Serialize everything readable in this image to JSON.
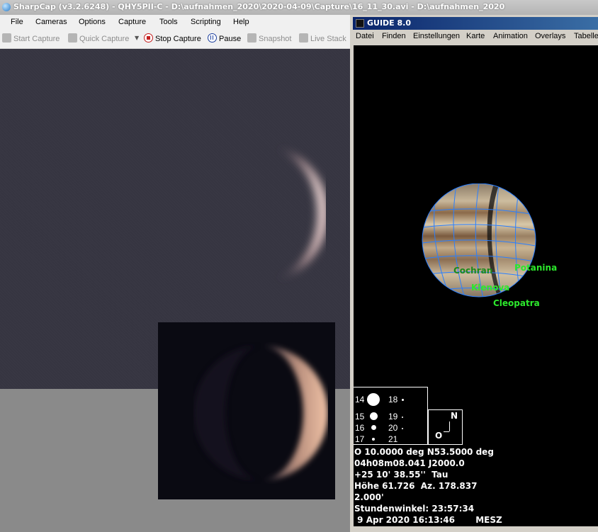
{
  "sharpcap": {
    "title": "SharpCap (v3.2.6248) - QHY5PII-C - D:\\aufnahmen_2020\\2020-04-09\\Capture\\16_11_30.avi - D:\\aufnahmen_2020",
    "menu": [
      "File",
      "Cameras",
      "Options",
      "Capture",
      "Tools",
      "Scripting",
      "Help"
    ],
    "toolbar": {
      "start_capture": "Start Capture",
      "quick_capture": "Quick Capture",
      "stop_capture": "Stop Capture",
      "pause": "Pause",
      "snapshot": "Snapshot",
      "live_stack": "Live Stack"
    },
    "colors": {
      "stop": "#c41e1e",
      "pause": "#1c3f9e"
    }
  },
  "guide": {
    "title": "GUIDE 8.0",
    "menu": [
      "Datei",
      "Finden",
      "Einstellungen",
      "Karte",
      "Animation",
      "Overlays",
      "Tabelle"
    ],
    "features": {
      "cochran": "Cochran",
      "potanina": "Potanina",
      "klenova": "Klenova",
      "cleopatra": "Cleopatra"
    },
    "legend": [
      {
        "left": "14",
        "right": "18"
      },
      {
        "left": "15",
        "right": "19"
      },
      {
        "left": "16",
        "right": "20"
      },
      {
        "left": "17",
        "right": "21"
      }
    ],
    "compass": {
      "north": "N",
      "east": "O"
    },
    "info": {
      "line1": "O 10.0000 deg N53.5000 deg",
      "line2": "04h08m08.041 J2000.0",
      "line3": "+25 10' 38.55''  Tau",
      "line4": "Höhe 61.726  Az. 178.837",
      "line5": "2.000'",
      "line6": "Stundenwinkel: 23:57:34",
      "line7": " 9 Apr 2020 16:13:46       MESZ"
    },
    "colors": {
      "feature_label": "#2ce82c",
      "grid": "#2a7fff"
    }
  }
}
